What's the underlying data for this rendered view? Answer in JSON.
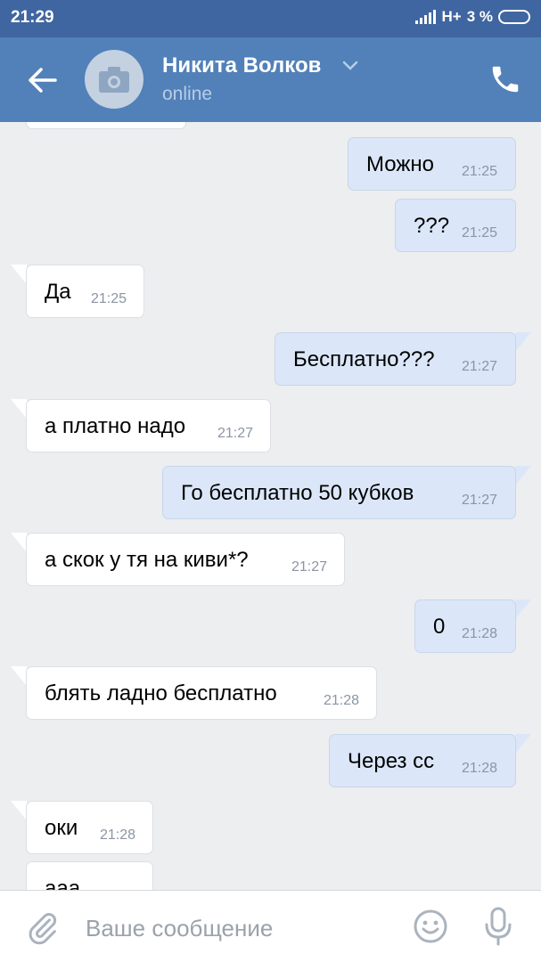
{
  "status_bar": {
    "time": "21:29",
    "network": "H+",
    "battery": "3 %"
  },
  "header": {
    "contact_name": "Никита Волков",
    "contact_status": "online"
  },
  "messages": [
    {
      "dir": "out",
      "text": "Можно",
      "time": "21:25"
    },
    {
      "dir": "out",
      "text": "???",
      "time": "21:25"
    },
    {
      "dir": "in",
      "text": "Да",
      "time": "21:25"
    },
    {
      "dir": "out",
      "text": "Бесплатно???",
      "time": "21:27"
    },
    {
      "dir": "in",
      "text": "а платно надо",
      "time": "21:27"
    },
    {
      "dir": "out",
      "text": "Го бесплатно 50 кубков",
      "time": "21:27"
    },
    {
      "dir": "in",
      "text": "а скок у тя на киви*?",
      "time": "21:27"
    },
    {
      "dir": "out",
      "text": "0",
      "time": "21:28"
    },
    {
      "dir": "in",
      "text": "блять ладно бесплатно",
      "time": "21:28"
    },
    {
      "dir": "out",
      "text": "Через сс",
      "time": "21:28"
    },
    {
      "dir": "in",
      "text": "оки",
      "time": "21:28"
    },
    {
      "dir": "in",
      "text": "ааа",
      "time": ""
    }
  ],
  "composer": {
    "placeholder": "Ваше сообщение",
    "value": ""
  },
  "colors": {
    "header": "#5281b9",
    "status_bar": "#3f66a0",
    "incoming": "#ffffff",
    "outgoing": "#dbe7f8",
    "background": "#edeef0"
  }
}
